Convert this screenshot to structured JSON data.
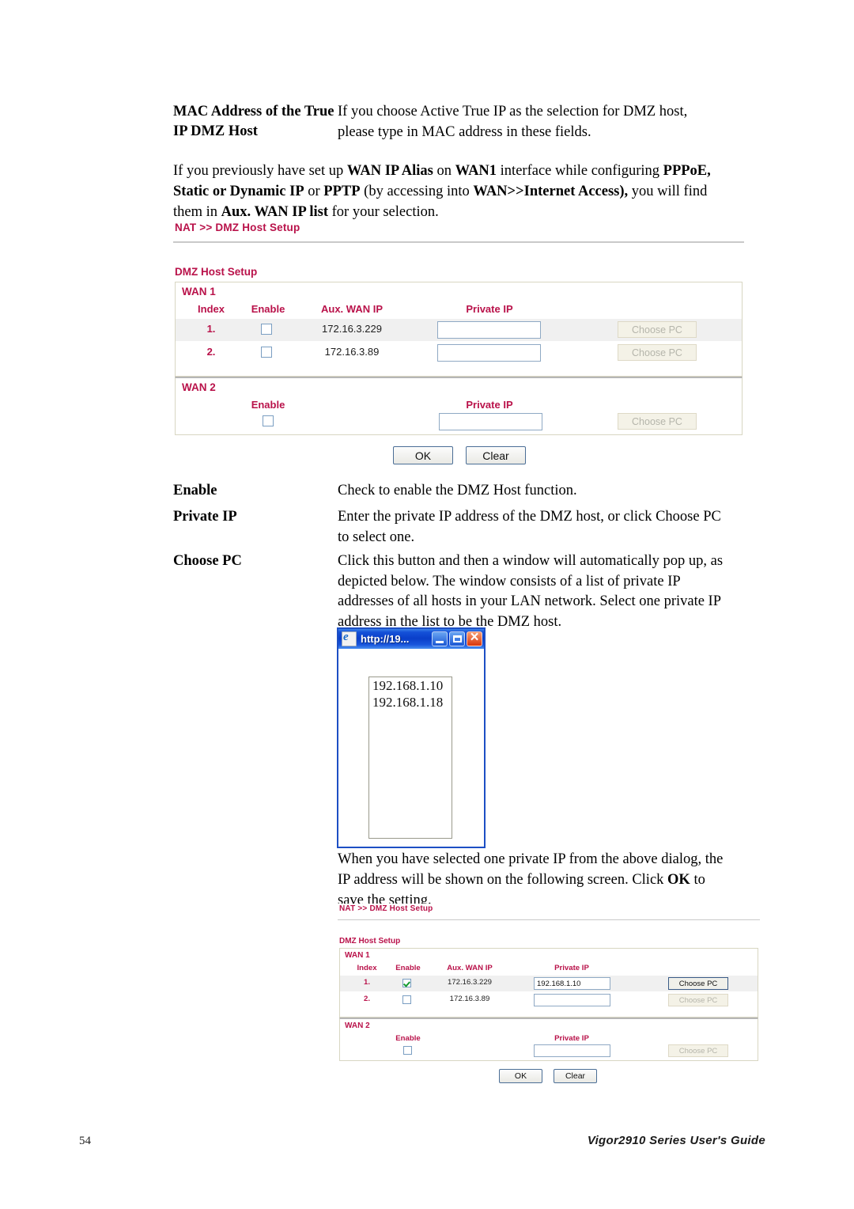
{
  "doc": {
    "definitions_top": [
      {
        "term_line1": "MAC Address of the True",
        "term_line2": "IP DMZ Host",
        "desc_line1": "If you choose Active True IP as the selection for DMZ host,",
        "desc_line2": "please type in MAC address in these fields."
      }
    ],
    "paragraph_intro": {
      "line1_a": "If you previously have set up ",
      "line1_b": "WAN IP Alias",
      "line1_c": " on ",
      "line1_d": "WAN1",
      "line1_e": " interface while configuring ",
      "line1_f": "PPPoE,",
      "line2_a": "Static or Dynamic IP",
      "line2_b": " or ",
      "line2_c": "PPTP",
      "line2_d": " (by accessing into ",
      "line2_e": "WAN>>Internet Access),",
      "line2_f": " you will find",
      "line3_a": "them in ",
      "line3_b": "Aux. WAN IP list",
      "line3_c": " for your selection."
    },
    "definitions_mid": [
      {
        "term": "Enable",
        "lines": [
          "Check to enable the DMZ Host function."
        ]
      },
      {
        "term": "Private IP",
        "lines": [
          "Enter the private IP address of the DMZ host, or click Choose PC",
          "to select one."
        ]
      },
      {
        "term": "Choose PC",
        "lines": [
          "Click this button and then a window will automatically pop up, as",
          "depicted below. The window consists of a list of private IP",
          "addresses of all hosts in your LAN network. Select one private IP",
          "address in the list to be the DMZ host."
        ]
      }
    ],
    "paragraph_after_popup": {
      "line1": "When you have selected one private IP from the above dialog, the",
      "line2_a": "IP address will be shown on the following screen. Click ",
      "line2_b": "OK",
      "line2_c": " to",
      "line3": "save the setting."
    }
  },
  "screenshot_top": {
    "breadcrumb": "NAT >> DMZ Host Setup",
    "section_title": "DMZ Host Setup",
    "wan1": {
      "label": "WAN 1",
      "columns": [
        "Index",
        "Enable",
        "Aux. WAN IP",
        "Private IP"
      ],
      "rows": [
        {
          "index": "1.",
          "enabled": false,
          "aux_wan_ip": "172.16.3.229",
          "private_ip": "",
          "choose_pc_label": "Choose PC",
          "choose_pc_enabled": false,
          "shaded": true
        },
        {
          "index": "2.",
          "enabled": false,
          "aux_wan_ip": "172.16.3.89",
          "private_ip": "",
          "choose_pc_label": "Choose PC",
          "choose_pc_enabled": false,
          "shaded": false
        }
      ]
    },
    "wan2": {
      "label": "WAN 2",
      "columns": [
        "Enable",
        "Private IP"
      ],
      "row": {
        "enabled": false,
        "private_ip": "",
        "choose_pc_label": "Choose PC",
        "choose_pc_enabled": false
      }
    },
    "buttons": {
      "ok": "OK",
      "clear": "Clear"
    }
  },
  "popup": {
    "title": "http://19...",
    "icon": "ie-page-icon",
    "window_buttons": {
      "minimize": "minimize-icon",
      "maximize": "maximize-icon",
      "close": "close-icon"
    },
    "list_options": [
      "192.168.1.10",
      "192.168.1.18"
    ]
  },
  "screenshot_bottom": {
    "breadcrumb": "NAT >> DMZ Host Setup",
    "section_title": "DMZ Host Setup",
    "wan1": {
      "label": "WAN 1",
      "columns": [
        "Index",
        "Enable",
        "Aux. WAN IP",
        "Private IP"
      ],
      "rows": [
        {
          "index": "1.",
          "enabled": true,
          "aux_wan_ip": "172.16.3.229",
          "private_ip": "192.168.1.10",
          "choose_pc_label": "Choose PC",
          "choose_pc_enabled": true,
          "shaded": true
        },
        {
          "index": "2.",
          "enabled": false,
          "aux_wan_ip": "172.16.3.89",
          "private_ip": "",
          "choose_pc_label": "Choose PC",
          "choose_pc_enabled": false,
          "shaded": false
        }
      ]
    },
    "wan2": {
      "label": "WAN 2",
      "columns": [
        "Enable",
        "Private IP"
      ],
      "row": {
        "enabled": false,
        "private_ip": "",
        "choose_pc_label": "Choose PC",
        "choose_pc_enabled": false
      }
    },
    "buttons": {
      "ok": "OK",
      "clear": "Clear"
    }
  },
  "footer": {
    "page_number": "54",
    "guide_title": "Vigor2910 Series User's Guide"
  },
  "colors": {
    "accent_crimson": "#b9124a",
    "panel_border": "#d8d6c2",
    "row_shade": "#f0f0f0",
    "input_border": "#8fa9c4",
    "check_green": "#139b2f",
    "title_bar_blue": "#0a3fc9",
    "close_red": "#d8360d"
  }
}
